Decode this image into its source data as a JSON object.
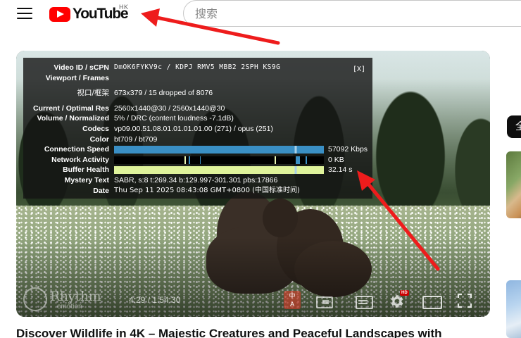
{
  "header": {
    "logo_text": "YouTube",
    "region": "HK",
    "search_placeholder": "搜索"
  },
  "stats": {
    "close_label": "[X]",
    "rows": [
      {
        "label": "Video ID / sCPN",
        "value": "DmOK6FYKV9c  /  KDPJ RMV5 MBB2 2SPH KS9G"
      },
      {
        "label": "Viewport / Frames",
        "value": ""
      },
      {
        "label": "视口/框架",
        "value": "673x379 / 15 dropped of 8076"
      },
      {
        "label": "Current / Optimal Res",
        "value": "2560x1440@30 / 2560x1440@30"
      },
      {
        "label": "Volume / Normalized",
        "value": "5% / DRC (content loudness -7.1dB)"
      },
      {
        "label": "Codecs",
        "value": "vp09.00.51.08.01.01.01.01.00 (271) / opus (251)"
      },
      {
        "label": "Color",
        "value": "bt709 / bt709"
      },
      {
        "label": "Connection Speed",
        "value": "57092 Kbps"
      },
      {
        "label": "Network Activity",
        "value": "0 KB"
      },
      {
        "label": "Buffer Health",
        "value": "32.14 s"
      },
      {
        "label": "Mystery Text",
        "value": "SABR, s:8 t:269.34 b:129.997-301.301 pbs:17866"
      },
      {
        "label": "Date",
        "value": "Thu Sep 11 2025 08:43:08 GMT+0800 (中国标准时间)"
      }
    ]
  },
  "player": {
    "watermark_text": "Rhythm",
    "watermark_sub": "emotion",
    "time_current": "4:29",
    "time_total": "1:54:30",
    "cc_label": "中\nA",
    "hd_badge": "HD"
  },
  "video": {
    "title": "Discover Wildlife in 4K – Majestic Creatures and Peaceful Landscapes with"
  },
  "sidebar": {
    "chip_label": "全"
  },
  "colors": {
    "brand_red": "#ff0000",
    "annotation_red": "#ee1c1c",
    "speed_bar": "#3a8fc4",
    "buffer_bar": "#dff39b"
  }
}
